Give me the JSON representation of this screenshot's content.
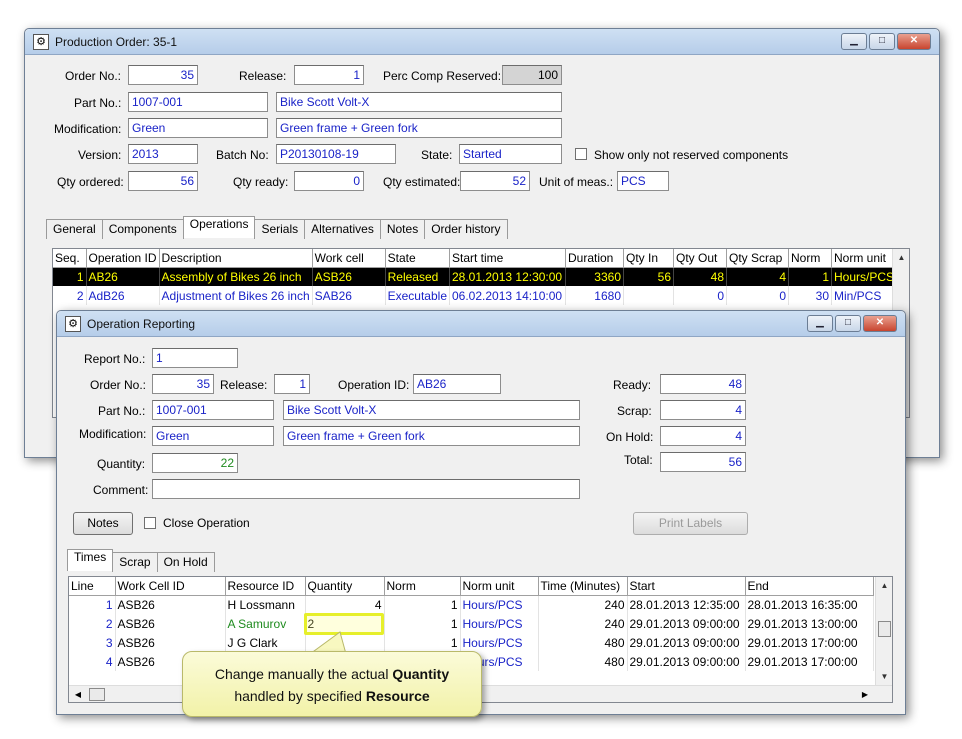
{
  "prod_window": {
    "title": "Production Order: 35-1",
    "labels": {
      "order_no": "Order No.:",
      "release": "Release:",
      "perc_comp": "Perc Comp Reserved:",
      "part_no": "Part No.:",
      "modification": "Modification:",
      "version": "Version:",
      "batch_no": "Batch No:",
      "state": "State:",
      "show_only": "Show only not reserved components",
      "qty_ordered": "Qty ordered:",
      "qty_ready": "Qty ready:",
      "qty_estimated": "Qty estimated:",
      "unit": "Unit of meas.:"
    },
    "values": {
      "order_no": "35",
      "release": "1",
      "perc_comp": "100",
      "part_no": "1007-001",
      "part_desc": "Bike Scott Volt-X",
      "modification": "Green",
      "modification_desc": "Green frame + Green fork",
      "version": "2013",
      "batch_no": "P20130108-19",
      "state": "Started",
      "qty_ordered": "56",
      "qty_ready": "0",
      "qty_estimated": "52",
      "unit": "PCS"
    },
    "tabs": [
      "General",
      "Components",
      "Operations",
      "Serials",
      "Alternatives",
      "Notes",
      "Order history"
    ],
    "active_tab": "Operations",
    "ops_columns": [
      "Seq.",
      "Operation ID",
      "Description",
      "Work cell",
      "State",
      "Start time",
      "Duration",
      "Qty In",
      "Qty Out",
      "Qty Scrap",
      "Norm",
      "Norm unit"
    ],
    "ops_rows": [
      [
        "1",
        "AB26",
        "Assembly of Bikes 26 inch",
        "ASB26",
        "Released",
        "28.01.2013 12:30:00",
        "3360",
        "56",
        "48",
        "4",
        "1",
        "Hours/PCS"
      ],
      [
        "2",
        "AdB26",
        "Adjustment of Bikes 26 inch",
        "SAB26",
        "Executable",
        "06.02.2013 14:10:00",
        "1680",
        "",
        "0",
        "0",
        "30",
        "Min/PCS"
      ]
    ]
  },
  "op_window": {
    "title": "Operation Reporting",
    "labels": {
      "report_no": "Report No.:",
      "order_no": "Order No.:",
      "release": "Release:",
      "operation_id": "Operation ID:",
      "part_no": "Part No.:",
      "modification": "Modification:",
      "quantity": "Quantity:",
      "comment": "Comment:",
      "ready": "Ready:",
      "scrap": "Scrap:",
      "on_hold": "On Hold:",
      "total": "Total:",
      "close_operation": "Close Operation"
    },
    "values": {
      "report_no": "1",
      "order_no": "35",
      "release": "1",
      "operation_id": "AB26",
      "part_no": "1007-001",
      "part_desc": "Bike Scott Volt-X",
      "modification": "Green",
      "modification_desc": "Green frame + Green fork",
      "quantity": "22",
      "comment": "",
      "ready": "48",
      "scrap": "4",
      "on_hold": "4",
      "total": "56"
    },
    "buttons": {
      "notes": "Notes",
      "print_labels": "Print Labels"
    },
    "tabs": [
      "Times",
      "Scrap",
      "On Hold"
    ],
    "active_tab": "Times",
    "times_columns": [
      "Line",
      "Work Cell ID",
      "Resource ID",
      "Quantity",
      "Norm",
      "Norm unit",
      "Time (Minutes)",
      "Start",
      "End"
    ],
    "times_rows": [
      [
        "1",
        "ASB26",
        "H Lossmann",
        "4",
        "1",
        "Hours/PCS",
        "240",
        "28.01.2013 12:35:00",
        "28.01.2013 16:35:00"
      ],
      [
        "2",
        "ASB26",
        "A Samurov",
        "2",
        "1",
        "Hours/PCS",
        "240",
        "29.01.2013 09:00:00",
        "29.01.2013 13:00:00"
      ],
      [
        "3",
        "ASB26",
        "J G Clark",
        "",
        "1",
        "Hours/PCS",
        "480",
        "29.01.2013 09:00:00",
        "29.01.2013 17:00:00"
      ],
      [
        "4",
        "ASB26",
        "",
        "",
        "1",
        "Hours/PCS",
        "480",
        "29.01.2013 09:00:00",
        "29.01.2013 17:00:00"
      ]
    ]
  },
  "callout": {
    "text_1": "Change manually the actual ",
    "bold_1": "Quantity",
    "text_2": "handled by specified ",
    "bold_2": "Resource"
  },
  "colors": {
    "value_blue": "#1a23c8",
    "selected_row": "#000000",
    "selected_text": "#ffff00",
    "callout": "#f6f6b8"
  }
}
